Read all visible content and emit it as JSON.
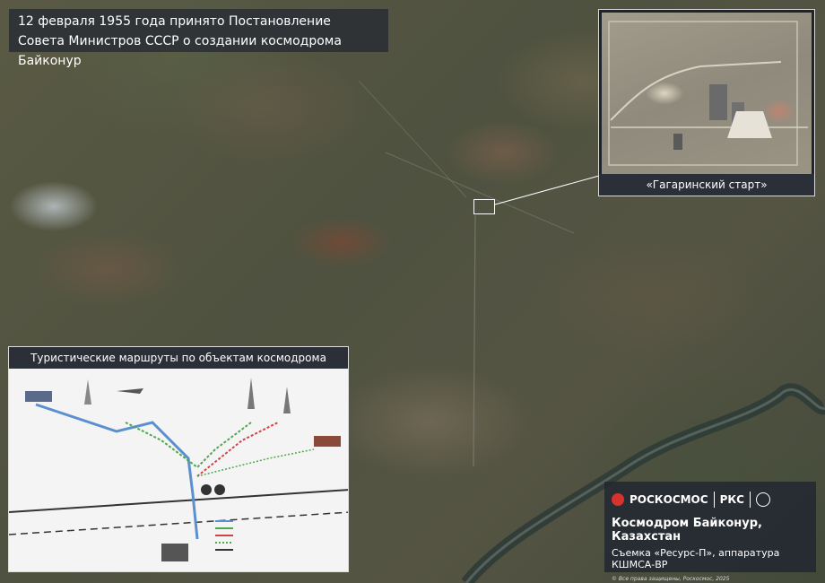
{
  "title": {
    "line1": "12 февраля 1955 года принято Постановление",
    "line2": "Совета Министров СССР о создании космодрома Байконур"
  },
  "inset": {
    "caption": "«Гагаринский старт»"
  },
  "routes_map": {
    "heading": "Туристические маршруты по объектам космодрома",
    "landmarks": [
      "aircraft-icon",
      "rocket-icon",
      "building-icon",
      "antenna-icon"
    ]
  },
  "branding": {
    "logo1": "РОСКОСМОС",
    "logo2": "РКС",
    "location": "Космодром Байконур, Казахстан",
    "credit": "Съемка «Ресурс-П», аппаратура КШМСА-ВР",
    "copyright": "© Все права защищены, Роскосмос, 2025"
  },
  "colors": {
    "route_blue": "#5b8fd0",
    "route_green": "#4ea84e",
    "route_red": "#d04444",
    "panel_bg": "#2a2f38"
  }
}
